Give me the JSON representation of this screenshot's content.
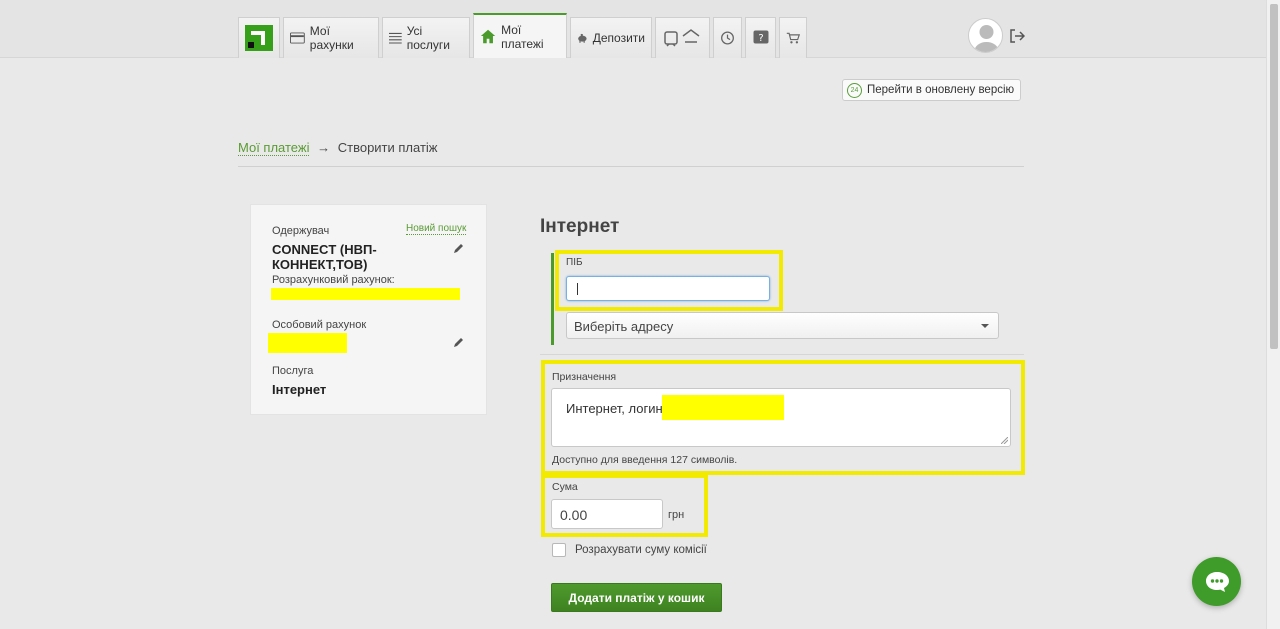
{
  "nav": {
    "tabs": [
      {
        "label": "Мої рахунки",
        "icon": "card-icon"
      },
      {
        "label": "Усі послуги",
        "icon": "list-icon"
      },
      {
        "label": "Мої платежі",
        "icon": "home-icon"
      },
      {
        "label": "Депозити",
        "icon": "piggy-bank-icon"
      }
    ],
    "icon_tabs": [
      "transport-icon",
      "globe-icon",
      "history-icon",
      "help-icon",
      "cart-icon"
    ]
  },
  "new_version_badge": "24",
  "new_version_label": "Перейти в оновлену версію",
  "breadcrumb": {
    "parent": "Мої платежі",
    "arrow": "→",
    "current": "Створити платіж"
  },
  "recipient_card": {
    "recipient_label": "Одержувач",
    "new_search": "Новий пошук",
    "recipient_name": "CONNECT (НВП-КОННЕКТ,ТОВ)",
    "account_label": "Розрахунковий рахунок:",
    "personal_account_label": "Особовий рахунок",
    "service_label": "Послуга",
    "service_value": "Інтернет"
  },
  "form": {
    "title": "Інтернет",
    "pib_label": "ПІБ",
    "pib_value": "",
    "address_select": "Виберіть адресу",
    "purpose_label": "Призначення",
    "purpose_value": "Интернет, логин",
    "chars_hint": "Доступно для введення 127 символів.",
    "amount_label": "Сума",
    "amount_value": "0.00",
    "currency": "грн",
    "commission_label": "Розрахувати суму комісії",
    "commission_checked": false,
    "submit": "Додати платіж у кошик"
  },
  "colors": {
    "accent": "#4b9b2c",
    "highlight": "#ffff00",
    "annotation": "#f2ea00"
  }
}
